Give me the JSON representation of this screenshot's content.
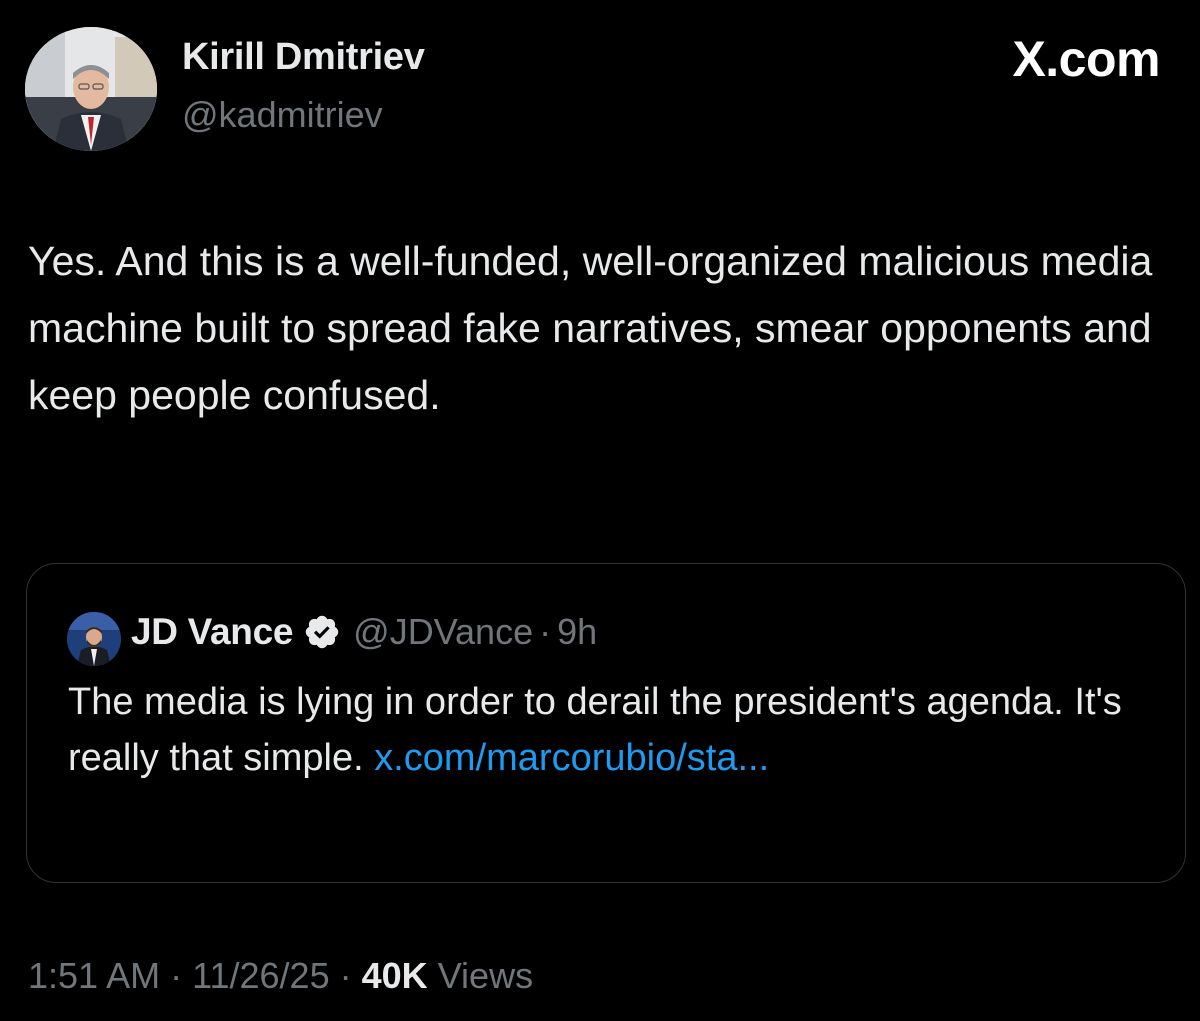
{
  "author": {
    "display_name": "Kirill Dmitriev",
    "handle": "@kadmitriev",
    "avatar_icon": "profile-photo"
  },
  "brand": {
    "label": "X.com"
  },
  "tweet": {
    "text": "Yes. And this is a well-funded, well-organized malicious media machine built to spread fake narratives, smear opponents and keep people confused."
  },
  "quoted_tweet": {
    "display_name": "JD Vance",
    "verified_icon": "verified-badge-icon",
    "handle": "@JDVance",
    "separator": "·",
    "time": "9h",
    "text": "The media is lying in order to derail the president's agenda. It's really that simple.",
    "link_text": "x.com/marcorubio/sta..."
  },
  "meta": {
    "time": "1:51 AM",
    "separator": "·",
    "date": "11/26/25",
    "views_count": "40K",
    "views_label": "Views"
  },
  "colors": {
    "background": "#000000",
    "primary_text": "#e7e9ea",
    "secondary_text": "#71767b",
    "link": "#1d9bf0",
    "border": "#2f3336"
  }
}
